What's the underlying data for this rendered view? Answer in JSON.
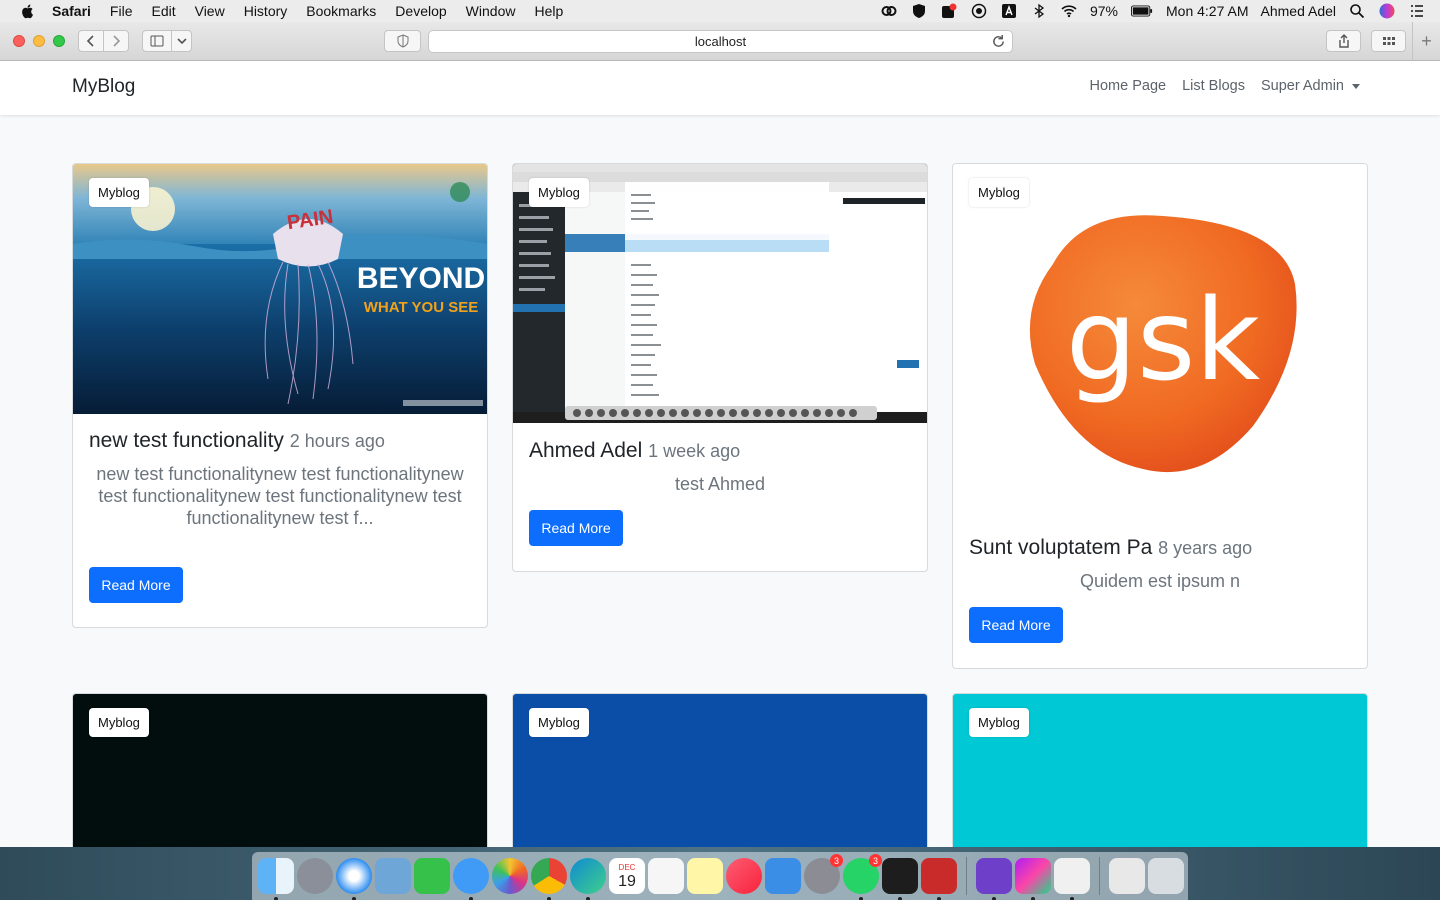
{
  "menubar": {
    "app_name": "Safari",
    "items": [
      "File",
      "Edit",
      "View",
      "History",
      "Bookmarks",
      "Develop",
      "Window",
      "Help"
    ],
    "battery": "97%",
    "clock": "Mon 4:27 AM",
    "user": "Ahmed Adel"
  },
  "browser": {
    "url": "localhost"
  },
  "site": {
    "brand": "MyBlog",
    "nav": {
      "home": "Home Page",
      "list": "List Blogs",
      "admin": "Super Admin"
    }
  },
  "cards": [
    {
      "badge": "Myblog",
      "title": "new test functionality",
      "time": "2 hours ago",
      "excerpt": "new test functionalitynew test functionalitynew test functionalitynew test functionalitynew test functionalitynew test f...",
      "button": "Read More",
      "image_text": {
        "word1": "PAIN",
        "word2": "BEYOND",
        "word3": "WHAT YOU SEE"
      }
    },
    {
      "badge": "Myblog",
      "title": "Ahmed Adel",
      "time": "1 week ago",
      "excerpt": "test Ahmed",
      "button": "Read More"
    },
    {
      "badge": "Myblog",
      "title": "Sunt voluptatem Pa",
      "time": "8 years ago",
      "excerpt": "Quidem est ipsum n",
      "button": "Read More",
      "image_text": {
        "logo": "gsk"
      }
    },
    {
      "badge": "Myblog",
      "image_color": "#020d0d"
    },
    {
      "badge": "Myblog",
      "image_color": "#0b4ea8"
    },
    {
      "badge": "Myblog",
      "image_color": "#00c8d4"
    }
  ],
  "dock": {
    "badges": {
      "settings": "3",
      "whatsapp": "3"
    },
    "calendar": {
      "month": "DEC",
      "day": "19"
    }
  },
  "colors": {
    "primary": "#0d6efd",
    "page_bg": "#f8f9fa"
  }
}
